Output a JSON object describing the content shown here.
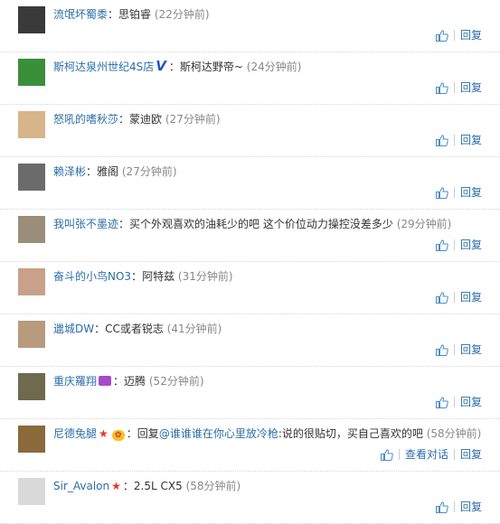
{
  "colors": {
    "link": "#2b6ea7",
    "text": "#333333",
    "time": "#888888",
    "vip_v": "#1f55c9",
    "star": "#e23b1f"
  },
  "icons": {
    "like": "thumbs-up-icon"
  },
  "comments": [
    {
      "user": "流氓坏蜀黍",
      "badges": [],
      "sep": "：",
      "text": "思铂睿",
      "time": "(22分钟前)",
      "actions": [
        "回复"
      ],
      "avatar_color": "#3a3a3a"
    },
    {
      "user": "斯柯达泉州世纪4S店",
      "badges": [
        "verified-v"
      ],
      "sep": "：",
      "text": "斯柯达野帝~",
      "time": "(24分钟前)",
      "actions": [
        "回复"
      ],
      "avatar_color": "#3a8f3a"
    },
    {
      "user": "怒吼的嗜秋莎",
      "badges": [],
      "sep": "：",
      "text": "蒙迪欧",
      "time": "(27分钟前)",
      "actions": [
        "回复"
      ],
      "avatar_color": "#d8b48b"
    },
    {
      "user": "赖泽彬",
      "badges": [],
      "sep": "：",
      "text": "雅阁",
      "time": "(27分钟前)",
      "actions": [
        "回复"
      ],
      "avatar_color": "#6b6b6b"
    },
    {
      "user": "我叫张不墨迹",
      "badges": [],
      "sep": "：",
      "text": "买个外观喜欢的油耗少的吧 这个价位动力操控没差多少",
      "time": "(29分钟前)",
      "actions": [
        "回复"
      ],
      "avatar_color": "#9a8e7a"
    },
    {
      "user": "奋斗的小鸟NO3",
      "badges": [],
      "sep": "：",
      "text": "阿特兹",
      "time": "(31分钟前)",
      "actions": [
        "回复"
      ],
      "avatar_color": "#c9a08a"
    },
    {
      "user": "邋城DW",
      "badges": [],
      "sep": "：",
      "text": "CC或者锐志",
      "time": "(41分钟前)",
      "actions": [
        "回复"
      ],
      "avatar_color": "#b89a7c"
    },
    {
      "user": "重庆羅翔",
      "badges": [
        "tv"
      ],
      "sep": "：",
      "text": "迈腾",
      "time": "(52分钟前)",
      "actions": [
        "回复"
      ],
      "avatar_color": "#6f6a4e"
    },
    {
      "user": "尼德兔腿",
      "badges": [
        "star",
        "vip"
      ],
      "sep": "：",
      "reply_prefix": "回复",
      "mention": "@谁谁谁在你心里放冷枪",
      "text": ":说的很贴切，买自己喜欢的吧",
      "time": "(58分钟前)",
      "actions": [
        "查看对话",
        "回复"
      ],
      "avatar_color": "#8a6a3a"
    },
    {
      "user": "Sir_Avalon",
      "badges": [
        "star"
      ],
      "sep": "：",
      "text": "2.5L CX5",
      "time": "(58分钟前)",
      "actions": [
        "回复"
      ],
      "avatar_color": "#d9d9d9"
    }
  ]
}
